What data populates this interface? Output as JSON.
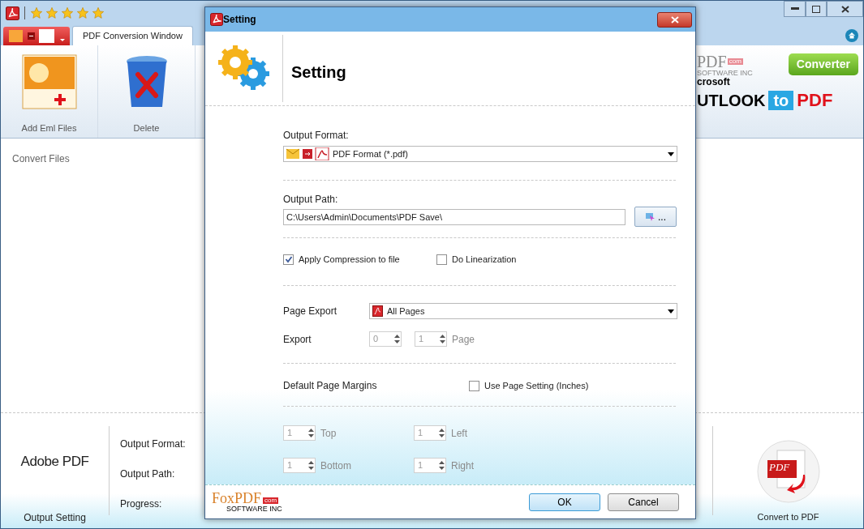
{
  "main_window": {
    "stars": 5,
    "tab": {
      "label": "PDF Conversion Window",
      "selected": true
    },
    "ribbon": [
      {
        "label": "Add Eml Files",
        "kind": "add"
      },
      {
        "label": "Delete",
        "kind": "delete"
      }
    ],
    "banner": {
      "brand": "PDF",
      "brand_suffix": "com",
      "company": "SOFTWARE INC",
      "line_1": "crosoft",
      "line_2": "UTLOOK",
      "tag": "Converter",
      "word_to": "to",
      "word_pdf": "PDF"
    },
    "left_panel": {
      "title": "Convert Files"
    },
    "bottom": {
      "logo_text": "Adobe PDF",
      "caption": "Output Setting",
      "labels": [
        "Output Format:",
        "Output Path:",
        "Progress:"
      ],
      "convert": "Convert to PDF",
      "convert_icon_text": "PDF"
    }
  },
  "dialog": {
    "title": "Setting",
    "heading": "Setting",
    "output_format": {
      "label": "Output Format:",
      "value": "PDF Format (*.pdf)"
    },
    "output_path": {
      "label": "Output Path:",
      "value": "C:\\Users\\Admin\\Documents\\PDF Save\\",
      "browse": "..."
    },
    "options": [
      {
        "label": "Apply Compression to file",
        "checked": true
      },
      {
        "label": "Do Linearization",
        "checked": false
      }
    ],
    "page_export": {
      "label": "Page Export",
      "value": "All Pages"
    },
    "export": {
      "label": "Export",
      "from": "0",
      "to": "1",
      "unit": "Page",
      "disabled": true
    },
    "margins": {
      "label": "Default Page Margins",
      "use_page_setting": {
        "label": "Use Page Setting (Inches)",
        "checked": false
      },
      "disabled": true,
      "fields": [
        {
          "value": "1",
          "side": "Top"
        },
        {
          "value": "1",
          "side": "Left"
        },
        {
          "value": "1",
          "side": "Bottom"
        },
        {
          "value": "1",
          "side": "Right"
        }
      ]
    },
    "footer_logo": {
      "brand": "FoxPDF",
      "suffix": "com",
      "company": "SOFTWARE INC"
    },
    "buttons": [
      {
        "label": "OK",
        "default": true
      },
      {
        "label": "Cancel",
        "default": false
      }
    ]
  }
}
